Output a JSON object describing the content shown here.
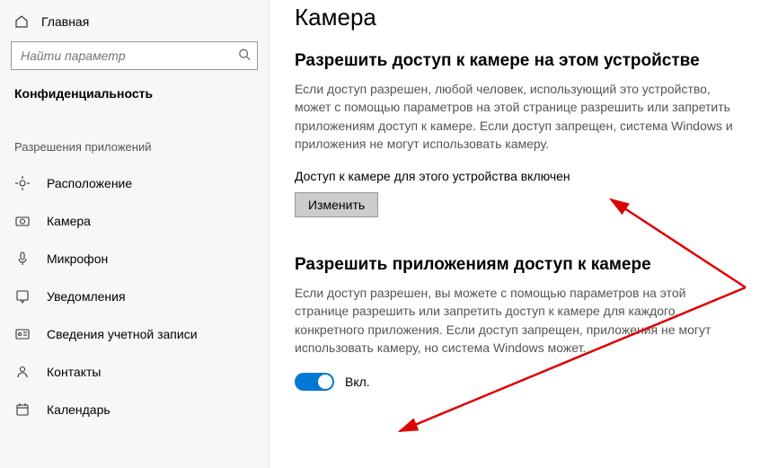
{
  "sidebar": {
    "home_label": "Главная",
    "search_placeholder": "Найти параметр",
    "section_title": "Конфиденциальность",
    "subsection_label": "Разрешения приложений",
    "items": [
      {
        "label": "Расположение",
        "icon": "location-icon"
      },
      {
        "label": "Камера",
        "icon": "camera-icon"
      },
      {
        "label": "Микрофон",
        "icon": "microphone-icon"
      },
      {
        "label": "Уведомления",
        "icon": "notifications-icon"
      },
      {
        "label": "Сведения учетной записи",
        "icon": "account-info-icon"
      },
      {
        "label": "Контакты",
        "icon": "contacts-icon"
      },
      {
        "label": "Календарь",
        "icon": "calendar-icon"
      }
    ]
  },
  "main": {
    "page_title": "Камера",
    "section1": {
      "title": "Разрешить доступ к камере на этом устройстве",
      "desc": "Если доступ разрешен, любой человек, использующий это устройство, может с помощью параметров на этой странице разрешить или запретить приложениям доступ к камере. Если доступ запрещен, система Windows и приложения не могут использовать камеру.",
      "status": "Доступ к камере для этого устройства включен",
      "change_button": "Изменить"
    },
    "section2": {
      "title": "Разрешить приложениям доступ к камере",
      "desc": "Если доступ разрешен, вы можете с помощью параметров на этой странице разрешить или запретить доступ к камере для каждого конкретного приложения. Если доступ запрещен, приложения не могут использовать камеру, но система Windows может.",
      "toggle_label": "Вкл."
    }
  }
}
